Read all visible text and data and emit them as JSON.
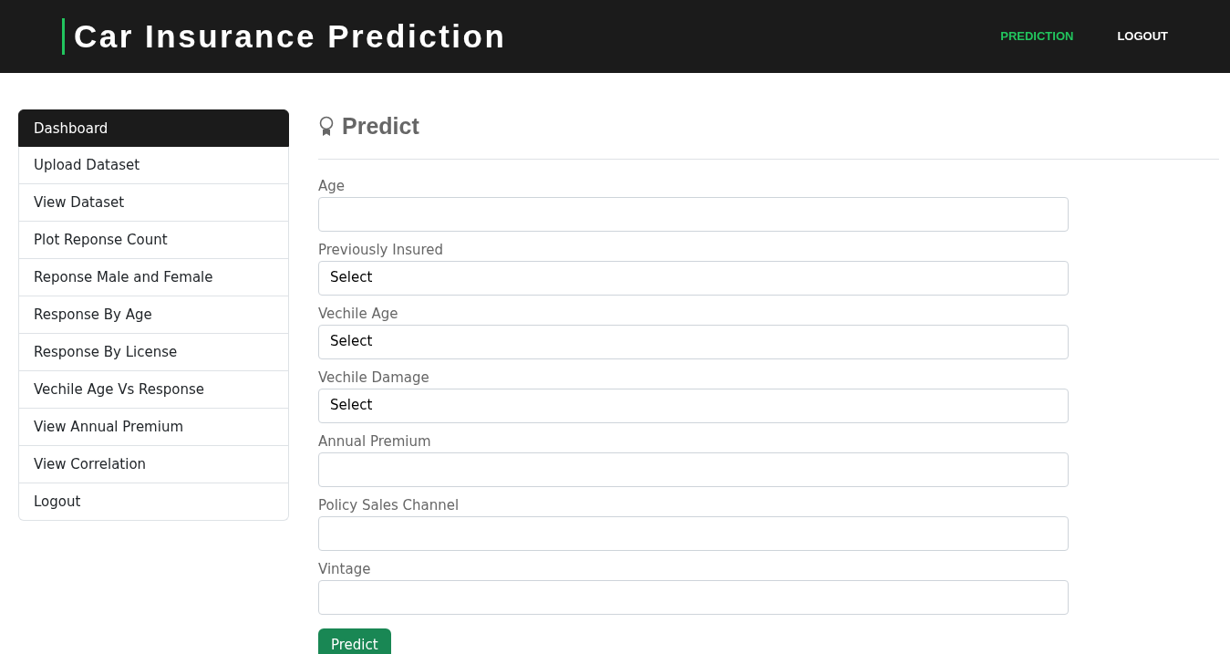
{
  "navbar": {
    "title": "Car Insurance Prediction",
    "links": [
      {
        "label": "PREDICTION",
        "selected": true
      },
      {
        "label": "LOGOUT",
        "selected": false
      }
    ]
  },
  "sidebar": {
    "items": [
      {
        "label": "Dashboard",
        "selected": true
      },
      {
        "label": "Upload Dataset",
        "selected": false
      },
      {
        "label": "View Dataset",
        "selected": false
      },
      {
        "label": "Plot Reponse Count",
        "selected": false
      },
      {
        "label": "Reponse Male and Female",
        "selected": false
      },
      {
        "label": "Response By Age",
        "selected": false
      },
      {
        "label": "Response By License",
        "selected": false
      },
      {
        "label": "Vechile Age Vs Response",
        "selected": false
      },
      {
        "label": "View Annual Premium",
        "selected": false
      },
      {
        "label": "View Correlation",
        "selected": false
      },
      {
        "label": "Logout",
        "selected": false
      }
    ]
  },
  "form": {
    "heading": "Predict",
    "fields": [
      {
        "label": "Age",
        "kind": "text"
      },
      {
        "label": "Previously Insured",
        "kind": "select",
        "value": "Select"
      },
      {
        "label": "Vechile Age",
        "kind": "select",
        "value": "Select"
      },
      {
        "label": "Vechile Damage",
        "kind": "select",
        "value": "Select"
      },
      {
        "label": "Annual Premium",
        "kind": "text"
      },
      {
        "label": "Policy Sales Channel",
        "kind": "text"
      },
      {
        "label": "Vintage",
        "kind": "text"
      }
    ],
    "submit": "Predict"
  }
}
